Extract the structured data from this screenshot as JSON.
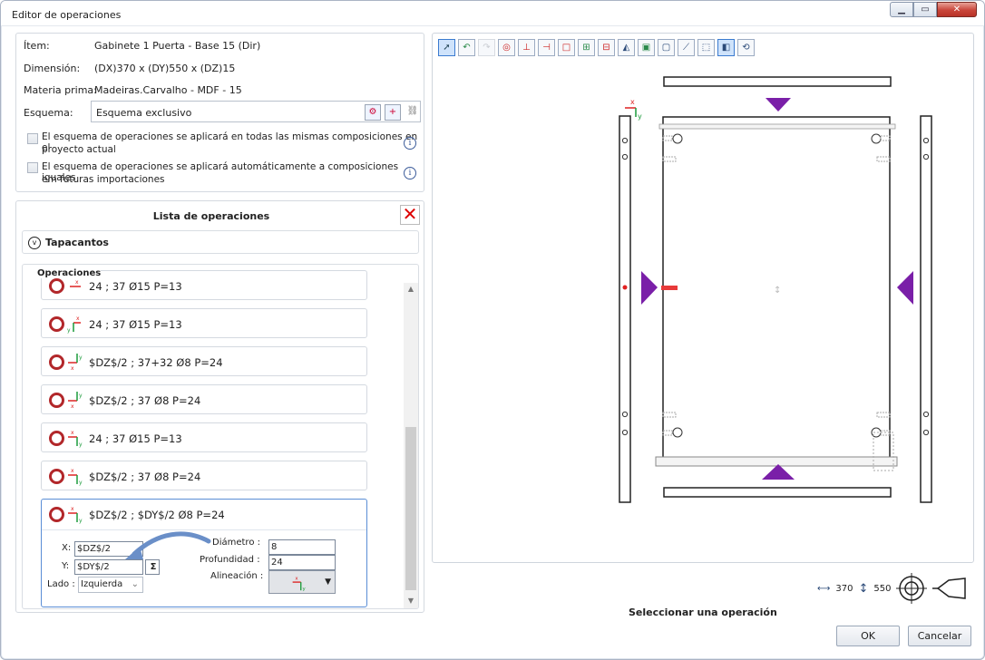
{
  "window": {
    "title": "Editor de operaciones"
  },
  "info": {
    "item_label": "Ítem:",
    "item_value": "Gabinete 1 Puerta - Base 15  (Dir)",
    "dim_label": "Dimensión:",
    "dim_value": "(DX)370 x (DY)550 x (DZ)15",
    "mat_label": "Materia prima:",
    "mat_value": "Madeiras.Carvalho - MDF - 15",
    "schema_label": "Esquema:",
    "schema_value": "Esquema exclusivo",
    "check1_line1": "El esquema de operaciones se aplicará en todas las mismas composiciones en el",
    "check1_line2": "proyecto actual",
    "check2_line1": "El esquema de operaciones se aplicará automáticamente a composiciones iguales",
    "check2_line2": "em futuras importaciones"
  },
  "ops": {
    "title": "Lista de operaciones",
    "tapacantos": "Tapacantos",
    "operaciones": "Operaciones",
    "items": [
      {
        "text": "24 ; 37 Ø15 P=13"
      },
      {
        "text": "24 ; 37 Ø15 P=13"
      },
      {
        "text": "$DZ$/2 ; 37+32 Ø8 P=24"
      },
      {
        "text": "$DZ$/2 ; 37 Ø8 P=24"
      },
      {
        "text": "24 ; 37 Ø15 P=13"
      },
      {
        "text": "$DZ$/2 ; 37 Ø8 P=24"
      },
      {
        "text": "$DZ$/2 ; $DY$/2 Ø8 P=24"
      }
    ],
    "editor": {
      "x_label": "X:",
      "x_value": "$DZ$/2",
      "y_label": "Y:",
      "y_value": "$DY$/2",
      "sigma": "Σ",
      "lado_label": "Lado :",
      "lado_value": "Izquierda",
      "diam_label": "Diámetro :",
      "diam_value": "8",
      "prof_label": "Profundidad :",
      "prof_value": "24",
      "alin_label": "Alineación :"
    }
  },
  "canvas": {
    "dx": "370",
    "dy": "550",
    "axis_x": "x",
    "axis_y": "y"
  },
  "status": "Seleccionar una operación",
  "buttons": {
    "ok": "OK",
    "cancel": "Cancelar"
  },
  "colors": {
    "accent": "#7a1fa8",
    "ring": "#b2272a",
    "selection": "#5a8ed6"
  }
}
